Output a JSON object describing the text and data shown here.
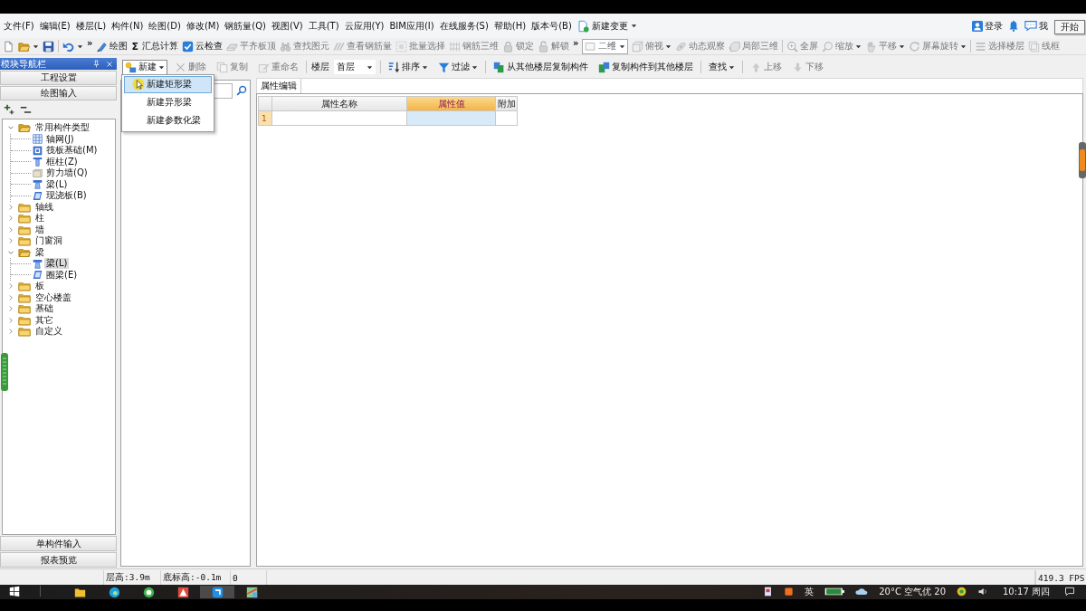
{
  "menu_bar": {
    "items": [
      "文件(F)",
      "编辑(E)",
      "楼层(L)",
      "构件(N)",
      "绘图(D)",
      "修改(M)",
      "钢筋量(Q)",
      "视图(V)",
      "工具(T)",
      "云应用(Y)",
      "BIM应用(I)",
      "在线服务(S)",
      "帮助(H)",
      "版本号(B)"
    ],
    "change_button": {
      "label": "新建变更",
      "has_menu": true
    },
    "login": "登录",
    "feedback": "我"
  },
  "tooltip": "开始",
  "toolbar": [
    {
      "kind": "icon",
      "has_menu": false
    },
    {
      "kind": "icon",
      "has_menu": true
    },
    {
      "kind": "icon",
      "has_menu": false
    },
    {
      "kind": "separator"
    },
    {
      "kind": "icon",
      "has_menu": true
    },
    {
      "kind": "overflow",
      "label": "»"
    },
    {
      "kind": "button",
      "label": "绘图",
      "disabled": false,
      "has_menu": false
    },
    {
      "kind": "button",
      "glyph": "Σ",
      "label": "汇总计算",
      "disabled": false,
      "has_menu": false
    },
    {
      "kind": "button",
      "label": "云检查",
      "disabled": false,
      "has_menu": false
    },
    {
      "kind": "button",
      "label": "平齐板顶",
      "disabled": true,
      "has_menu": false
    },
    {
      "kind": "button",
      "label": "查找图元",
      "disabled": true,
      "has_menu": false
    },
    {
      "kind": "button",
      "label": "查看钢筋量",
      "disabled": true,
      "has_menu": false
    },
    {
      "kind": "button",
      "label": "批量选择",
      "disabled": true,
      "has_menu": false
    },
    {
      "kind": "button",
      "label": "钢筋三维",
      "disabled": true,
      "has_menu": false
    },
    {
      "kind": "button",
      "label": "锁定",
      "disabled": true,
      "has_menu": false
    },
    {
      "kind": "button",
      "label": "解锁",
      "disabled": true,
      "has_menu": false
    },
    {
      "kind": "overflow",
      "label": "»"
    },
    {
      "kind": "combo",
      "label": "二维"
    },
    {
      "kind": "button",
      "label": "俯视",
      "disabled": true,
      "has_menu": true
    },
    {
      "kind": "button",
      "label": "动态观察",
      "disabled": true,
      "has_menu": false
    },
    {
      "kind": "button",
      "label": "局部三维",
      "disabled": true,
      "has_menu": false
    },
    {
      "kind": "separator"
    },
    {
      "kind": "button",
      "label": "全屏",
      "disabled": true,
      "has_menu": false
    },
    {
      "kind": "button",
      "label": "缩放",
      "disabled": true,
      "has_menu": true
    },
    {
      "kind": "button",
      "label": "平移",
      "disabled": true,
      "has_menu": true
    },
    {
      "kind": "button",
      "label": "屏幕旋转",
      "disabled": true,
      "has_menu": true
    },
    {
      "kind": "separator"
    },
    {
      "kind": "button",
      "label": "选择楼层",
      "disabled": true,
      "has_menu": false
    },
    {
      "kind": "button",
      "label": "线框",
      "disabled": true,
      "has_menu": false
    }
  ],
  "module_nav": {
    "title": "模块导航栏",
    "sections_top": [
      "工程设置",
      "绘图输入"
    ],
    "tree": [
      {
        "label": "常用构件类型",
        "kind": "folder",
        "expanded": true,
        "selected": false,
        "children": [
          {
            "label": "轴网(J)",
            "kind": "grid",
            "selected": false
          },
          {
            "label": "筏板基础(M)",
            "kind": "raft",
            "selected": false
          },
          {
            "label": "框柱(Z)",
            "kind": "column",
            "selected": false
          },
          {
            "label": "剪力墙(Q)",
            "kind": "wall",
            "selected": false
          },
          {
            "label": "梁(L)",
            "kind": "beam",
            "selected": false
          },
          {
            "label": "现浇板(B)",
            "kind": "slab",
            "selected": false
          }
        ]
      },
      {
        "label": "轴线",
        "kind": "folder",
        "expanded": false,
        "selected": false
      },
      {
        "label": "柱",
        "kind": "folder",
        "expanded": false,
        "selected": false
      },
      {
        "label": "墙",
        "kind": "folder",
        "expanded": false,
        "selected": false
      },
      {
        "label": "门窗洞",
        "kind": "folder",
        "expanded": false,
        "selected": false
      },
      {
        "label": "梁",
        "kind": "folder",
        "expanded": true,
        "selected": false,
        "children": [
          {
            "label": "梁(L)",
            "kind": "beam",
            "selected": true
          },
          {
            "label": "圈梁(E)",
            "kind": "slab",
            "selected": false
          }
        ]
      },
      {
        "label": "板",
        "kind": "folder",
        "expanded": false,
        "selected": false
      },
      {
        "label": "空心楼盖",
        "kind": "folder",
        "expanded": false,
        "selected": false
      },
      {
        "label": "基础",
        "kind": "folder",
        "expanded": false,
        "selected": false
      },
      {
        "label": "其它",
        "kind": "folder",
        "expanded": false,
        "selected": false
      },
      {
        "label": "自定义",
        "kind": "folder",
        "expanded": false,
        "selected": false
      }
    ],
    "sections_bottom": [
      "单构件输入",
      "报表预览"
    ]
  },
  "list_toolbar": [
    {
      "kind": "button",
      "label": "新建",
      "has_menu": true,
      "expanded": true,
      "disabled": false,
      "menu": [
        {
          "label": "新建矩形梁",
          "selected": true
        },
        {
          "label": "新建异形梁",
          "selected": false
        },
        {
          "label": "新建参数化梁",
          "selected": false
        }
      ]
    },
    {
      "kind": "button",
      "label": "删除",
      "disabled": true
    },
    {
      "kind": "button",
      "label": "复制",
      "disabled": true
    },
    {
      "kind": "button",
      "label": "重命名",
      "disabled": true
    },
    {
      "kind": "separator"
    },
    {
      "kind": "label",
      "label": "楼层"
    },
    {
      "kind": "combo",
      "label": "首层"
    },
    {
      "kind": "separator"
    },
    {
      "kind": "button",
      "label": "排序",
      "has_menu": true,
      "disabled": false
    },
    {
      "kind": "button",
      "label": "过滤",
      "has_menu": true,
      "disabled": false
    },
    {
      "kind": "separator"
    },
    {
      "kind": "button",
      "label": "从其他楼层复制构件",
      "disabled": false
    },
    {
      "kind": "button",
      "label": "复制构件到其他楼层",
      "disabled": false
    },
    {
      "kind": "separator"
    },
    {
      "kind": "button",
      "label": "查找",
      "has_menu": true,
      "disabled": false
    },
    {
      "kind": "separator"
    },
    {
      "kind": "button",
      "label": "上移",
      "disabled": true
    },
    {
      "kind": "button",
      "label": "下移",
      "disabled": true
    }
  ],
  "property_panel": {
    "tabs": [
      {
        "label": "属性编辑",
        "selected": true
      }
    ],
    "table": {
      "columns": [
        {
          "label": "属性名称",
          "selected": false
        },
        {
          "label": "属性值",
          "selected": true
        },
        {
          "label": "附加",
          "selected": false
        }
      ],
      "rows": [
        {
          "number": "1",
          "selected": true
        }
      ]
    }
  },
  "status_bar": {
    "floor_height": "层高:3.9m",
    "base_elevation": "底标高:-0.1m",
    "field_3": "0",
    "fps": "419.3 FPS"
  },
  "taskbar": {
    "apps": [
      {
        "selected": false
      },
      {
        "selected": false
      },
      {
        "selected": false
      },
      {
        "selected": false
      },
      {
        "selected": true
      },
      {
        "selected": false
      }
    ],
    "ime": "英",
    "weather": "20°C 空气优 20",
    "clock": "10:17 周四"
  }
}
